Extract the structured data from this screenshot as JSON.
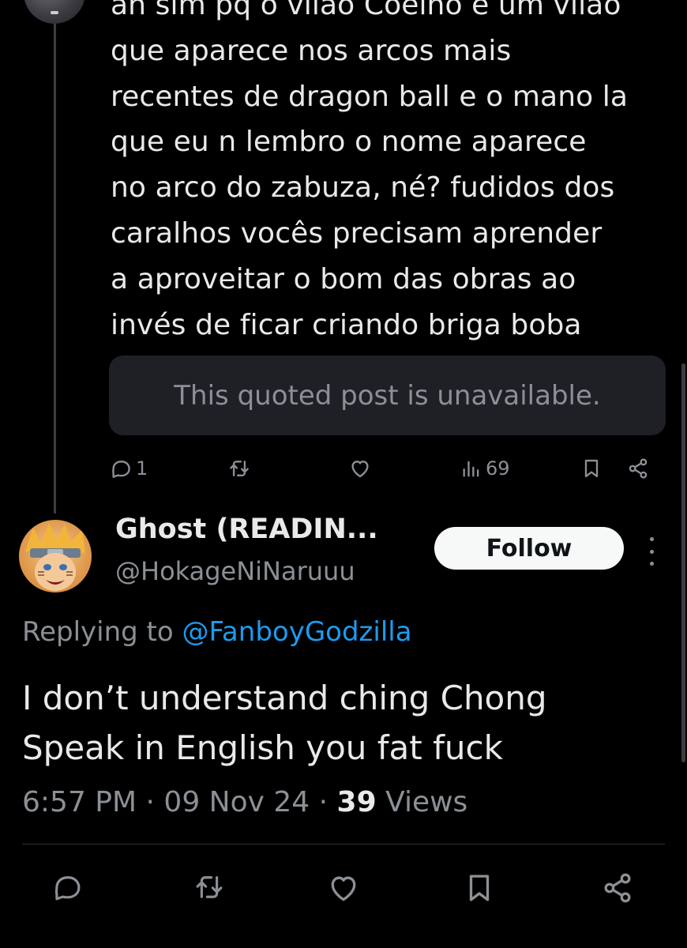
{
  "top_tweet": {
    "text_lines": [
      "ah sim pq o vilão Coelho é um vilão",
      "que aparece nos arcos mais",
      "recentes de dragon ball e o mano la",
      "que eu n lembro o nome aparece",
      "no arco do zabuza, né? fudidos dos",
      "caralhos vocês precisam aprender",
      "a aproveitar o bom das obras ao",
      "invés de ficar criando briga boba"
    ],
    "quoted_post": "This quoted post is unavailable.",
    "actions": {
      "reply_icon": "reply-icon",
      "reply_count": "1",
      "repost_icon": "repost-icon",
      "like_icon": "heart-icon",
      "views_icon": "views-icon",
      "views_count": "69",
      "bookmark_icon": "bookmark-icon",
      "share_icon": "share-icon"
    }
  },
  "reply_tweet": {
    "display_name": "Ghost (READIN...",
    "handle": "@HokageNiNaruuu",
    "follow_label": "Follow",
    "replying_to_prefix": "Replying to",
    "replying_to_mention": "@FanboyGodzilla",
    "text_lines": [
      "I don’t understand ching Chong",
      "Speak in English you fat fuck"
    ],
    "time": "6:57 PM",
    "date": "09 Nov 24",
    "views_count": "39",
    "views_label": "Views",
    "separator": "·",
    "actions": [
      "reply-icon",
      "repost-icon",
      "heart-icon",
      "bookmark-icon",
      "share-icon"
    ]
  },
  "colors": {
    "background": "#000000",
    "text_primary": "#e7e9ea",
    "text_secondary": "#8b9096",
    "link": "#1d9bf0",
    "quote_card_bg": "#1e2025",
    "follow_button_bg": "#f7f9f9"
  }
}
